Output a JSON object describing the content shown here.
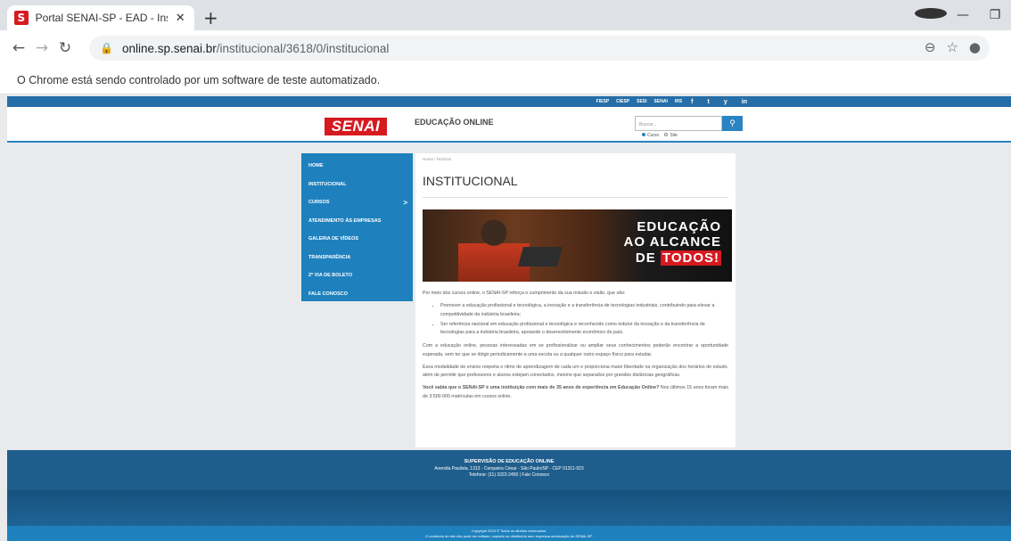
{
  "browser": {
    "tab_title": "Portal SENAI-SP - EAD - Institucio",
    "favicon_letter": "S",
    "new_tab": "+",
    "close": "✕",
    "url_host": "online.sp.senai.br",
    "url_path": "/institucional/3618/0/institucional",
    "infobar": "O Chrome está sendo controlado por um software de teste automatizado."
  },
  "site": {
    "top_links": [
      "FIESP",
      "CIESP",
      "SESI",
      "SENAI",
      "IRS"
    ],
    "socials": [
      "f",
      "t",
      "y",
      "in"
    ],
    "logo": "SENAI",
    "title": "EDUCAÇÃO ONLINE",
    "search_placeholder": "Buscar...",
    "search_icon": "search-icon",
    "radio_curso": "Curso",
    "radio_site": "Site"
  },
  "sidebar": {
    "items": [
      {
        "label": "HOME"
      },
      {
        "label": "INSTITUCIONAL"
      },
      {
        "label": "CURSOS"
      },
      {
        "label": "ATENDIMENTO ÀS EMPRESAS"
      },
      {
        "label": "GALERIA DE VÍDEOS"
      },
      {
        "label": "TRANSPARÊNCIA"
      },
      {
        "label": "2ª VIA DE BOLETO"
      },
      {
        "label": "FALE CONOSCO"
      }
    ],
    "chevron": ">"
  },
  "content": {
    "breadcrumb": "Home / Notícias",
    "title": "INSTITUCIONAL",
    "hero_line1": "EDUCAÇÃO",
    "hero_line2": "AO ALCANCE",
    "hero_line3a": "DE",
    "hero_line3b": "TODOS!",
    "intro": "Por meio dos cursos online, o SENAI-SP reforça o cumprimento da sua missão e visão, que são:",
    "bullet1": "Promover a educação profissional e tecnológica, a inovação e a transferência de tecnologias industriais, contribuindo para elevar a competitividade da indústria brasileira;",
    "bullet2": "Ser referência nacional em educação profissional e tecnológica e reconhecido como indutor da inovação e da transferência de tecnologias para a indústria brasileira, apoiando o desenvolvimento econômico do país.",
    "para1": "Com a educação online, pessoas interessadas em se profissionalizar ou ampliar seus conhecimentos poderão encontrar a oportunidade esperada, sem ter que se dirigir periodicamente a uma escola ou a qualquer outro espaço físico para estudar.",
    "para2": "Essa modalidade de ensino respeita o ritmo de aprendizagem de cada um e proporciona maior liberdade na organização dos horários de estudo, além de permitir que professores e alunos estejam conectados, mesmo que separados por grandes distâncias geográficas.",
    "para3_bold": "Você sabia que o SENAI-SP é uma instituição com mais de 35 anos de experiência em Educação Online?",
    "para3_rest": " Nos últimos 15 anos foram mais de 3.500.000 matrículas em cursos online."
  },
  "footer": {
    "title": "SUPERVISÃO DE EDUCAÇÃO ONLINE",
    "address": "Avenida Paulista, 1313 - Cerqueira César - São Paulo/SP - CEP 01311-923",
    "phone": "Telefone: (11) 3322-2450 | Fale Conosco",
    "copyright": "Copyright 2023 © Todos os direitos reservados.",
    "notice": "O conteúdo do site não pode ser editado, copiado ou distribuído sem expressa autorização do SENAI-SP."
  }
}
